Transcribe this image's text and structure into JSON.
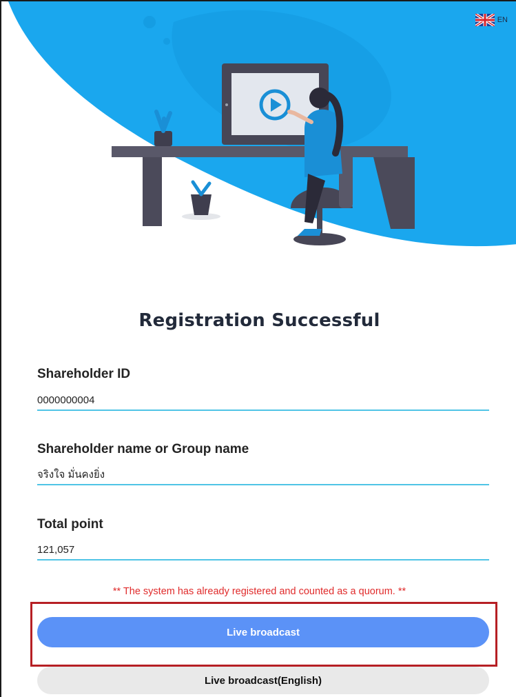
{
  "header": {
    "language_label": "EN",
    "flag_icon": "uk-flag-icon"
  },
  "hero": {
    "illustration": "woman-at-desk-watching-video-illustration",
    "accent_color": "#1aa7ee"
  },
  "title": "Registration Successful",
  "fields": [
    {
      "label": "Shareholder ID",
      "value": "0000000004"
    },
    {
      "label": "Shareholder name or Group name",
      "value": "จริงใจ มั่นคงยิ่ง"
    },
    {
      "label": "Total point",
      "value": "121,057"
    }
  ],
  "notice": "** The system has already registered and counted as a quorum. **",
  "buttons": {
    "live_broadcast": "Live broadcast",
    "live_broadcast_english": "Live broadcast(English)"
  },
  "colors": {
    "primary_button": "#5b92f7",
    "secondary_button": "#e9e9e9",
    "field_underline": "#4fc4e6",
    "notice_text": "#e02b2b",
    "highlight_border": "#b61f24"
  }
}
